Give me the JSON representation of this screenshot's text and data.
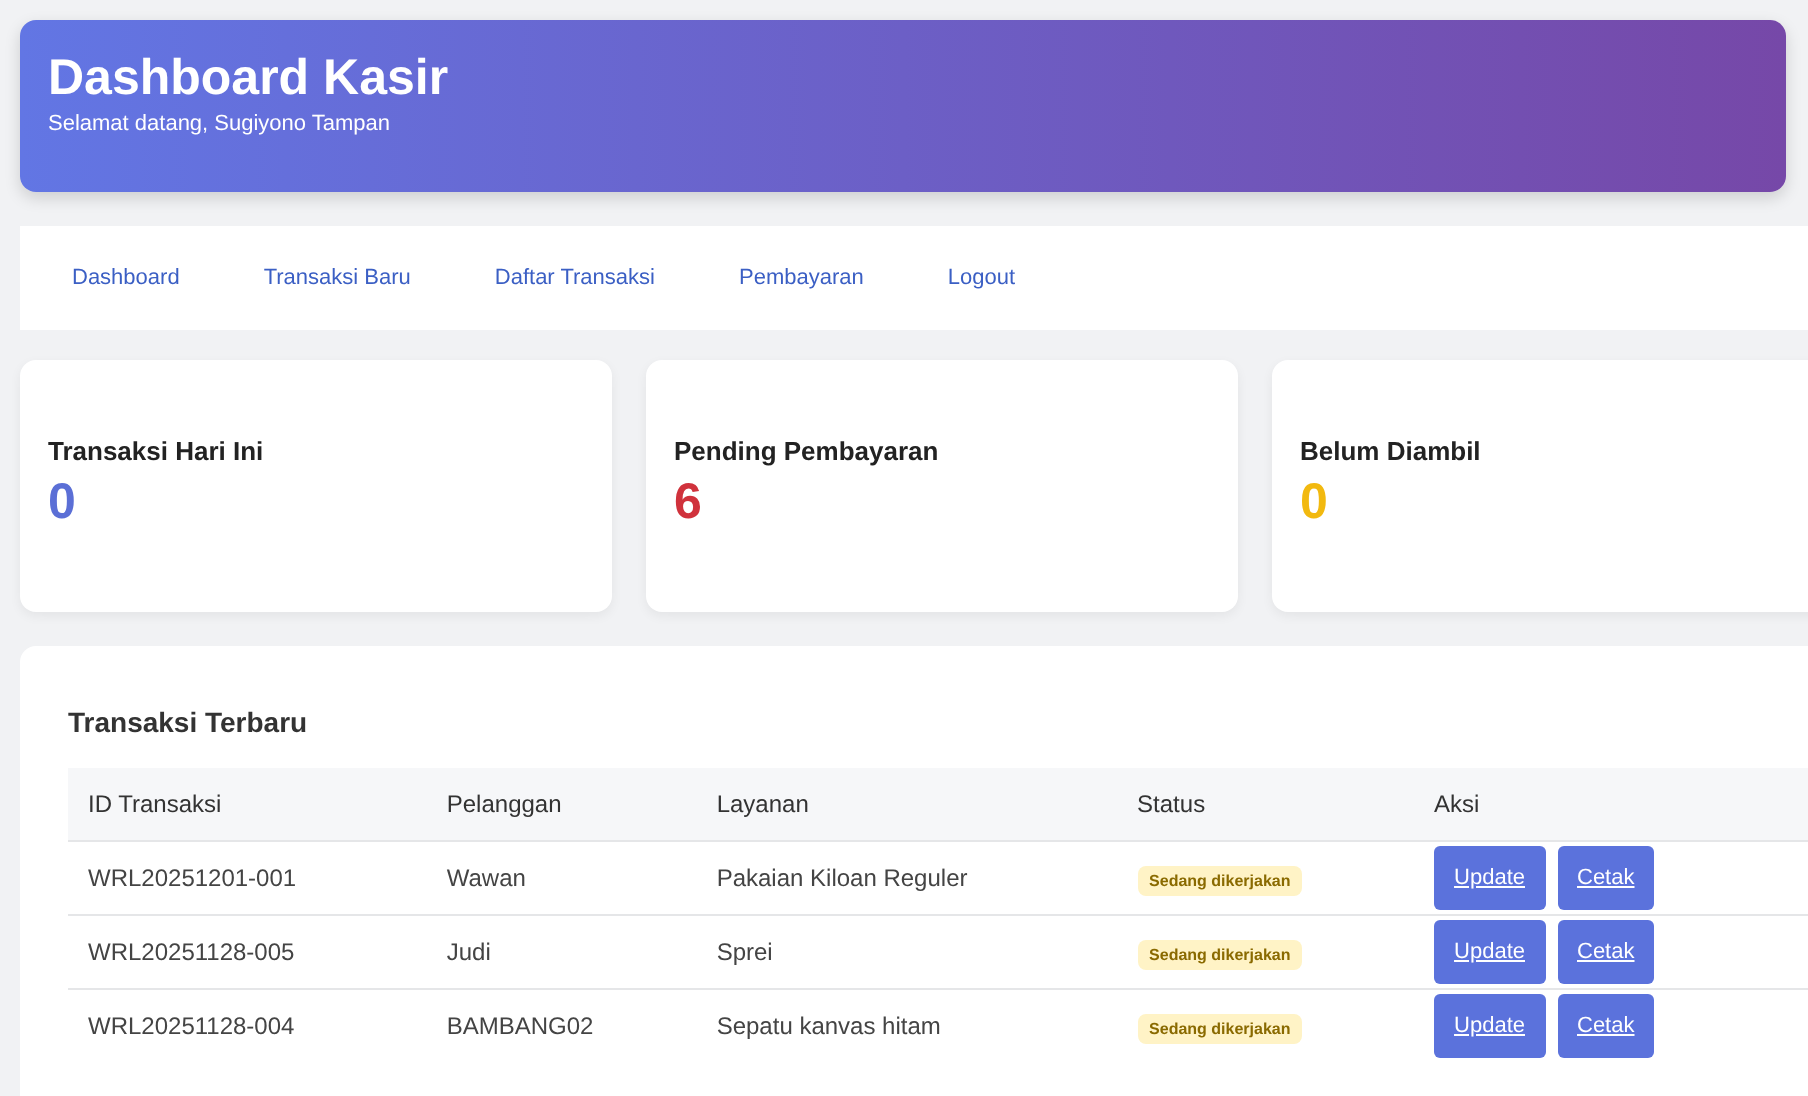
{
  "header": {
    "title": "Dashboard Kasir",
    "subtitle": "Selamat datang, Sugiyono Tampan"
  },
  "nav": [
    {
      "label": "Dashboard"
    },
    {
      "label": "Transaksi Baru"
    },
    {
      "label": "Daftar Transaksi"
    },
    {
      "label": "Pembayaran"
    },
    {
      "label": "Logout"
    }
  ],
  "stats": [
    {
      "label": "Transaksi Hari Ini",
      "value": "0",
      "color": "#5b6fd6"
    },
    {
      "label": "Pending Pembayaran",
      "value": "6",
      "color": "#d0323c"
    },
    {
      "label": "Belum Diambil",
      "value": "0",
      "color": "#f2b90f"
    }
  ],
  "table": {
    "title": "Transaksi Terbaru",
    "columns": [
      "ID Transaksi",
      "Pelanggan",
      "Layanan",
      "Status",
      "Aksi"
    ],
    "rows": [
      {
        "id": "WRL20251201-001",
        "customer": "Wawan",
        "service": "Pakaian Kiloan Reguler",
        "status": "Sedang dikerjakan",
        "actions": [
          "Update",
          "Cetak"
        ]
      },
      {
        "id": "WRL20251128-005",
        "customer": "Judi",
        "service": "Sprei",
        "status": "Sedang dikerjakan",
        "actions": [
          "Update",
          "Cetak"
        ]
      },
      {
        "id": "WRL20251128-004",
        "customer": "BAMBANG02",
        "service": "Sepatu kanvas hitam",
        "status": "Sedang dikerjakan",
        "actions": [
          "Update",
          "Cetak"
        ]
      }
    ]
  }
}
